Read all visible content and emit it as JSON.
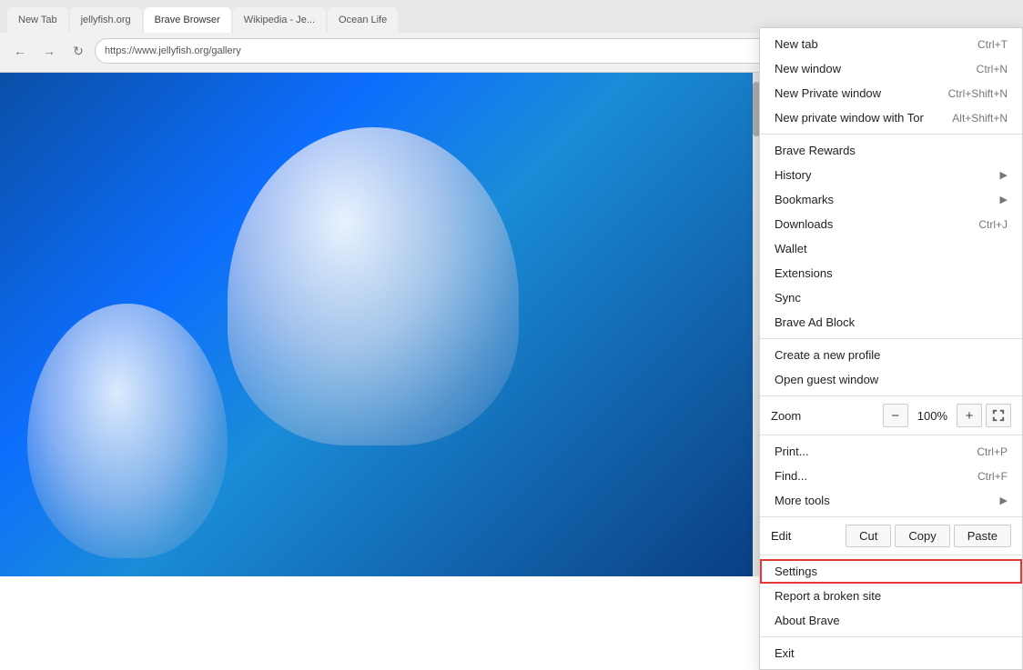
{
  "browser": {
    "tabs": [
      {
        "label": "New Tab",
        "active": false
      },
      {
        "label": "jellyfish.org",
        "active": false
      },
      {
        "label": "Brave Browser",
        "active": true
      },
      {
        "label": "Wikipedia - Jellyfish",
        "active": false
      },
      {
        "label": "Ocean Life",
        "active": false
      }
    ],
    "address": "https://www.jellyfish.org/gallery",
    "toolbar_icons": [
      "brave-lion-icon",
      "brave-rewards-icon",
      "brave-search-icon",
      "extensions-icon",
      "profile-icon",
      "puzzle-icon",
      "wallet-icon",
      "menu-icon"
    ]
  },
  "menu": {
    "items": [
      {
        "id": "new-tab",
        "label": "New tab",
        "shortcut": "Ctrl+T",
        "has_arrow": false,
        "separator_after": false
      },
      {
        "id": "new-window",
        "label": "New window",
        "shortcut": "Ctrl+N",
        "has_arrow": false,
        "separator_after": false
      },
      {
        "id": "new-private-window",
        "label": "New Private window",
        "shortcut": "Ctrl+Shift+N",
        "has_arrow": false,
        "separator_after": false
      },
      {
        "id": "new-private-tor",
        "label": "New private window with Tor",
        "shortcut": "Alt+Shift+N",
        "has_arrow": false,
        "separator_after": true
      },
      {
        "id": "brave-rewards",
        "label": "Brave Rewards",
        "shortcut": "",
        "has_arrow": false,
        "separator_after": false
      },
      {
        "id": "history",
        "label": "History",
        "shortcut": "",
        "has_arrow": true,
        "separator_after": false
      },
      {
        "id": "bookmarks",
        "label": "Bookmarks",
        "shortcut": "",
        "has_arrow": true,
        "separator_after": false
      },
      {
        "id": "downloads",
        "label": "Downloads",
        "shortcut": "Ctrl+J",
        "has_arrow": false,
        "separator_after": false
      },
      {
        "id": "wallet",
        "label": "Wallet",
        "shortcut": "",
        "has_arrow": false,
        "separator_after": false
      },
      {
        "id": "extensions",
        "label": "Extensions",
        "shortcut": "",
        "has_arrow": false,
        "separator_after": false
      },
      {
        "id": "sync",
        "label": "Sync",
        "shortcut": "",
        "has_arrow": false,
        "separator_after": false
      },
      {
        "id": "brave-ad-block",
        "label": "Brave Ad Block",
        "shortcut": "",
        "has_arrow": false,
        "separator_after": true
      },
      {
        "id": "create-profile",
        "label": "Create a new profile",
        "shortcut": "",
        "has_arrow": false,
        "separator_after": false
      },
      {
        "id": "guest-window",
        "label": "Open guest window",
        "shortcut": "",
        "has_arrow": false,
        "separator_after": true
      },
      {
        "id": "zoom",
        "label": "Zoom",
        "shortcut": "",
        "is_zoom": true,
        "separator_after": true
      },
      {
        "id": "print",
        "label": "Print...",
        "shortcut": "Ctrl+P",
        "has_arrow": false,
        "separator_after": false
      },
      {
        "id": "find",
        "label": "Find...",
        "shortcut": "Ctrl+F",
        "has_arrow": false,
        "separator_after": false
      },
      {
        "id": "more-tools",
        "label": "More tools",
        "shortcut": "",
        "has_arrow": true,
        "separator_after": true
      },
      {
        "id": "edit",
        "label": "Edit",
        "shortcut": "",
        "is_edit": true,
        "separator_after": true
      },
      {
        "id": "settings",
        "label": "Settings",
        "shortcut": "",
        "has_arrow": false,
        "separator_after": false,
        "highlighted": true
      },
      {
        "id": "report-broken",
        "label": "Report a broken site",
        "shortcut": "",
        "has_arrow": false,
        "separator_after": false
      },
      {
        "id": "about-brave",
        "label": "About Brave",
        "shortcut": "",
        "has_arrow": false,
        "separator_after": true
      },
      {
        "id": "exit",
        "label": "Exit",
        "shortcut": "",
        "has_arrow": false,
        "separator_after": false
      }
    ],
    "zoom": {
      "label": "Zoom",
      "minus": "−",
      "value": "100%",
      "plus": "+",
      "fullscreen": "⛶"
    },
    "edit": {
      "label": "Edit",
      "cut": "Cut",
      "copy": "Copy",
      "paste": "Paste"
    }
  }
}
